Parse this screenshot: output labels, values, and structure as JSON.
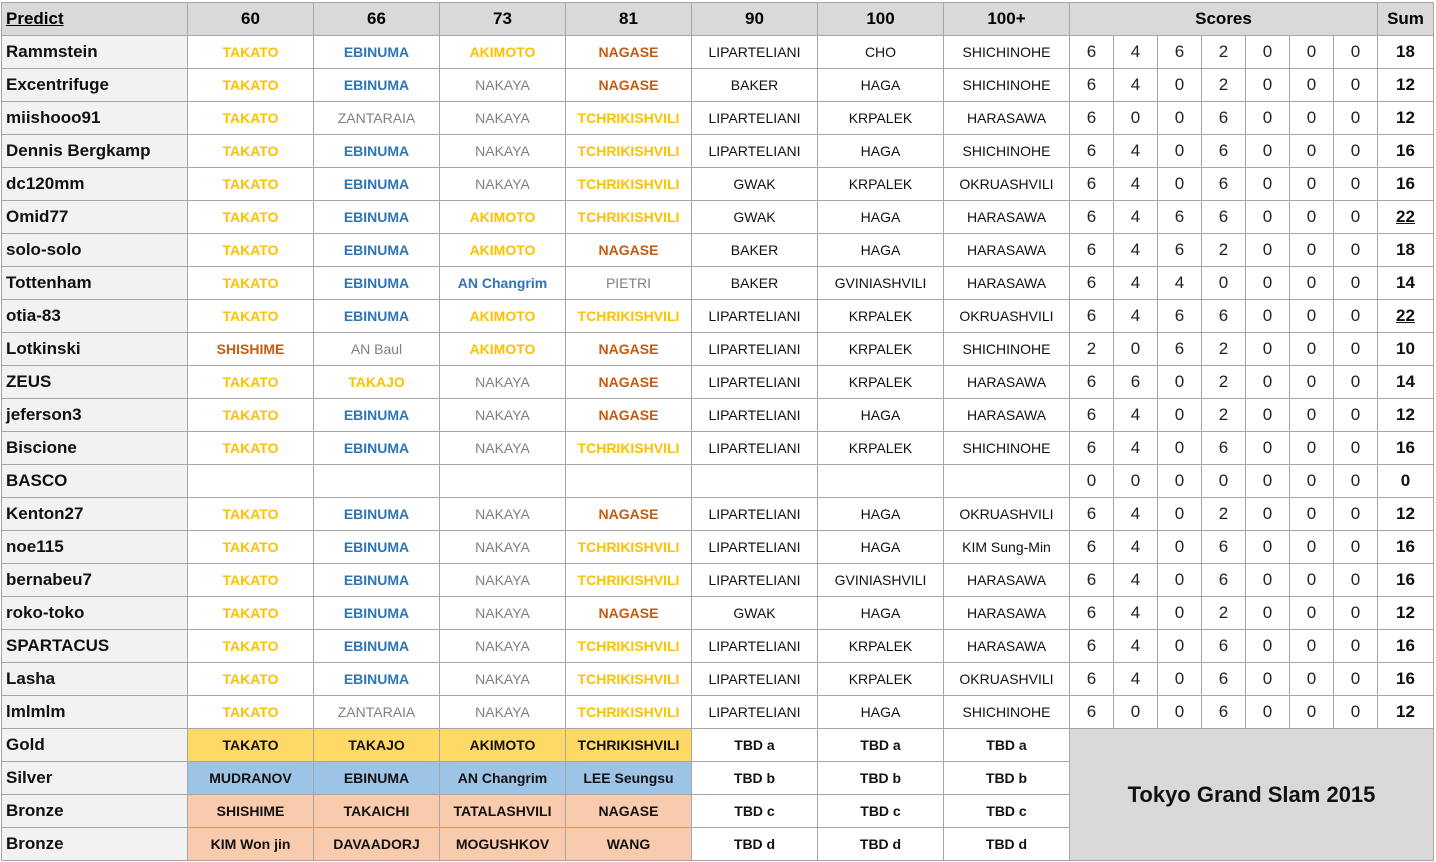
{
  "header": {
    "predict_label": "Predict",
    "weights": [
      "60",
      "66",
      "73",
      "81",
      "90",
      "100",
      "100+"
    ],
    "scores_label": "Scores",
    "sum_label": "Sum"
  },
  "rows": [
    {
      "name": "Rammstein",
      "picks": [
        "TAKATO",
        "EBINUMA",
        "AKIMOTO",
        "NAGASE",
        "LIPARTELIANI",
        "CHO",
        "SHICHINOHE"
      ],
      "scores": [
        6,
        4,
        6,
        2,
        0,
        0,
        0
      ],
      "sum": 18
    },
    {
      "name": "Excentrifuge",
      "picks": [
        "TAKATO",
        "EBINUMA",
        "NAKAYA",
        "NAGASE",
        "BAKER",
        "HAGA",
        "SHICHINOHE"
      ],
      "scores": [
        6,
        4,
        0,
        2,
        0,
        0,
        0
      ],
      "sum": 12
    },
    {
      "name": "miishooo91",
      "picks": [
        "TAKATO",
        "ZANTARAIA",
        "NAKAYA",
        "TCHRIKISHVILI",
        "LIPARTELIANI",
        "KRPALEK",
        "HARASAWA"
      ],
      "scores": [
        6,
        0,
        0,
        6,
        0,
        0,
        0
      ],
      "sum": 12
    },
    {
      "name": "Dennis Bergkamp",
      "picks": [
        "TAKATO",
        "EBINUMA",
        "NAKAYA",
        "TCHRIKISHVILI",
        "LIPARTELIANI",
        "HAGA",
        "SHICHINOHE"
      ],
      "scores": [
        6,
        4,
        0,
        6,
        0,
        0,
        0
      ],
      "sum": 16
    },
    {
      "name": "dc120mm",
      "picks": [
        "TAKATO",
        "EBINUMA",
        "NAKAYA",
        "TCHRIKISHVILI",
        "GWAK",
        "KRPALEK",
        "OKRUASHVILI"
      ],
      "scores": [
        6,
        4,
        0,
        6,
        0,
        0,
        0
      ],
      "sum": 16
    },
    {
      "name": "Omid77",
      "picks": [
        "TAKATO",
        "EBINUMA",
        "AKIMOTO",
        "TCHRIKISHVILI",
        "GWAK",
        "HAGA",
        "HARASAWA"
      ],
      "scores": [
        6,
        4,
        6,
        6,
        0,
        0,
        0
      ],
      "sum": 22
    },
    {
      "name": "solo-solo",
      "picks": [
        "TAKATO",
        "EBINUMA",
        "AKIMOTO",
        "NAGASE",
        "BAKER",
        "HAGA",
        "HARASAWA"
      ],
      "scores": [
        6,
        4,
        6,
        2,
        0,
        0,
        0
      ],
      "sum": 18
    },
    {
      "name": "Tottenham",
      "picks": [
        "TAKATO",
        "EBINUMA",
        "AN Changrim",
        "PIETRI",
        "BAKER",
        "GVINIASHVILI",
        "HARASAWA"
      ],
      "scores": [
        6,
        4,
        4,
        0,
        0,
        0,
        0
      ],
      "sum": 14
    },
    {
      "name": "otia-83",
      "picks": [
        "TAKATO",
        "EBINUMA",
        "AKIMOTO",
        "TCHRIKISHVILI",
        "LIPARTELIANI",
        "KRPALEK",
        "OKRUASHVILI"
      ],
      "scores": [
        6,
        4,
        6,
        6,
        0,
        0,
        0
      ],
      "sum": 22
    },
    {
      "name": "Lotkinski",
      "picks": [
        "SHISHIME",
        "AN Baul",
        "AKIMOTO",
        "NAGASE",
        "LIPARTELIANI",
        "KRPALEK",
        "SHICHINOHE"
      ],
      "scores": [
        2,
        0,
        6,
        2,
        0,
        0,
        0
      ],
      "sum": 10
    },
    {
      "name": "ZEUS",
      "picks": [
        "TAKATO",
        "TAKAJO",
        "NAKAYA",
        "NAGASE",
        "LIPARTELIANI",
        "KRPALEK",
        "HARASAWA"
      ],
      "scores": [
        6,
        6,
        0,
        2,
        0,
        0,
        0
      ],
      "sum": 14
    },
    {
      "name": "jeferson3",
      "picks": [
        "TAKATO",
        "EBINUMA",
        "NAKAYA",
        "NAGASE",
        "LIPARTELIANI",
        "HAGA",
        "HARASAWA"
      ],
      "scores": [
        6,
        4,
        0,
        2,
        0,
        0,
        0
      ],
      "sum": 12
    },
    {
      "name": "Biscione",
      "picks": [
        "TAKATO",
        "EBINUMA",
        "NAKAYA",
        "TCHRIKISHVILI",
        "LIPARTELIANI",
        "KRPALEK",
        "SHICHINOHE"
      ],
      "scores": [
        6,
        4,
        0,
        6,
        0,
        0,
        0
      ],
      "sum": 16
    },
    {
      "name": "BASCO",
      "picks": [
        "",
        "",
        "",
        "",
        "",
        "",
        ""
      ],
      "scores": [
        0,
        0,
        0,
        0,
        0,
        0,
        0
      ],
      "sum": 0
    },
    {
      "name": "Kenton27",
      "picks": [
        "TAKATO",
        "EBINUMA",
        "NAKAYA",
        "NAGASE",
        "LIPARTELIANI",
        "HAGA",
        "OKRUASHVILI"
      ],
      "scores": [
        6,
        4,
        0,
        2,
        0,
        0,
        0
      ],
      "sum": 12
    },
    {
      "name": "noe115",
      "picks": [
        "TAKATO",
        "EBINUMA",
        "NAKAYA",
        "TCHRIKISHVILI",
        "LIPARTELIANI",
        "HAGA",
        "KIM Sung-Min"
      ],
      "scores": [
        6,
        4,
        0,
        6,
        0,
        0,
        0
      ],
      "sum": 16
    },
    {
      "name": "bernabeu7",
      "picks": [
        "TAKATO",
        "EBINUMA",
        "NAKAYA",
        "TCHRIKISHVILI",
        "LIPARTELIANI",
        "GVINIASHVILI",
        "HARASAWA"
      ],
      "scores": [
        6,
        4,
        0,
        6,
        0,
        0,
        0
      ],
      "sum": 16
    },
    {
      "name": "roko-toko",
      "picks": [
        "TAKATO",
        "EBINUMA",
        "NAKAYA",
        "NAGASE",
        "GWAK",
        "HAGA",
        "HARASAWA"
      ],
      "scores": [
        6,
        4,
        0,
        2,
        0,
        0,
        0
      ],
      "sum": 12
    },
    {
      "name": "SPARTACUS",
      "picks": [
        "TAKATO",
        "EBINUMA",
        "NAKAYA",
        "TCHRIKISHVILI",
        "LIPARTELIANI",
        "KRPALEK",
        "HARASAWA"
      ],
      "scores": [
        6,
        4,
        0,
        6,
        0,
        0,
        0
      ],
      "sum": 16
    },
    {
      "name": "Lasha",
      "picks": [
        "TAKATO",
        "EBINUMA",
        "NAKAYA",
        "TCHRIKISHVILI",
        "LIPARTELIANI",
        "KRPALEK",
        "OKRUASHVILI"
      ],
      "scores": [
        6,
        4,
        0,
        6,
        0,
        0,
        0
      ],
      "sum": 16
    },
    {
      "name": "lmlmlm",
      "picks": [
        "TAKATO",
        "ZANTARAIA",
        "NAKAYA",
        "TCHRIKISHVILI",
        "LIPARTELIANI",
        "HAGA",
        "SHICHINOHE"
      ],
      "scores": [
        6,
        0,
        0,
        6,
        0,
        0,
        0
      ],
      "sum": 12
    }
  ],
  "medals": [
    {
      "label": "Gold",
      "kind": "gold",
      "results": [
        "TAKATO",
        "TAKAJO",
        "AKIMOTO",
        "TCHRIKISHVILI",
        "TBD a",
        "TBD a",
        "TBD a"
      ]
    },
    {
      "label": "Silver",
      "kind": "silver",
      "results": [
        "MUDRANOV",
        "EBINUMA",
        "AN Changrim",
        "LEE Seungsu",
        "TBD b",
        "TBD b",
        "TBD b"
      ]
    },
    {
      "label": "Bronze",
      "kind": "bronze",
      "results": [
        "SHISHIME",
        "TAKAICHI",
        "TATALASHVILI",
        "NAGASE",
        "TBD c",
        "TBD c",
        "TBD c"
      ]
    },
    {
      "label": "Bronze",
      "kind": "bronze",
      "results": [
        "KIM Won jin",
        "DAVAADORJ",
        "MOGUSHKOV",
        "WANG",
        "TBD d",
        "TBD d",
        "TBD d"
      ]
    }
  ],
  "event_title": "Tokyo Grand Slam 2015",
  "colors": {
    "gold_text": "#ffc000",
    "silver_text": "#2e75b6",
    "bronze_text": "#c55a11",
    "miss_text": "#808080",
    "gold_fill": "#ffd966",
    "silver_fill": "#9dc3e6",
    "bronze_fill": "#f8cbad",
    "header_fill": "#d9d9d9"
  }
}
